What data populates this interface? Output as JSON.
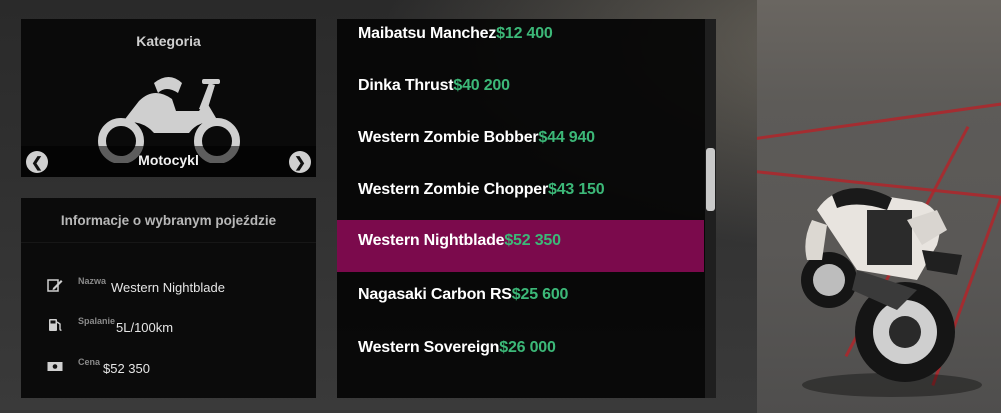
{
  "category": {
    "title": "Kategoria",
    "icon": "motorcycle-icon",
    "name": "Motocykl",
    "prev_icon": "arrow-left-icon",
    "next_icon": "arrow-right-icon"
  },
  "info": {
    "title": "Informacje o wybranym pojeździe",
    "rows": [
      {
        "icon": "edit-icon",
        "label": "Nazwa",
        "value": "Western Nightblade"
      },
      {
        "icon": "fuel-icon",
        "label": "Spalanie",
        "value": "5L/100km"
      },
      {
        "icon": "cash-icon",
        "label": "Cena",
        "value": "$52 350"
      }
    ]
  },
  "vehicles": [
    {
      "name": "Maibatsu Manchez",
      "price": "$12 400",
      "selected": false
    },
    {
      "name": "Dinka Thrust",
      "price": "$40 200",
      "selected": false
    },
    {
      "name": "Western Zombie Bobber",
      "price": "$44 940",
      "selected": false
    },
    {
      "name": "Western Zombie Chopper",
      "price": "$43 150",
      "selected": false
    },
    {
      "name": "Western Nightblade",
      "price": "$52 350",
      "selected": true
    },
    {
      "name": "Nagasaki Carbon RS",
      "price": "$25 600",
      "selected": false
    },
    {
      "name": "Western Sovereign",
      "price": "$26 000",
      "selected": false
    }
  ],
  "colors": {
    "selected": "#7b0a4c",
    "price": "#3cb878",
    "panel": "#080808"
  }
}
